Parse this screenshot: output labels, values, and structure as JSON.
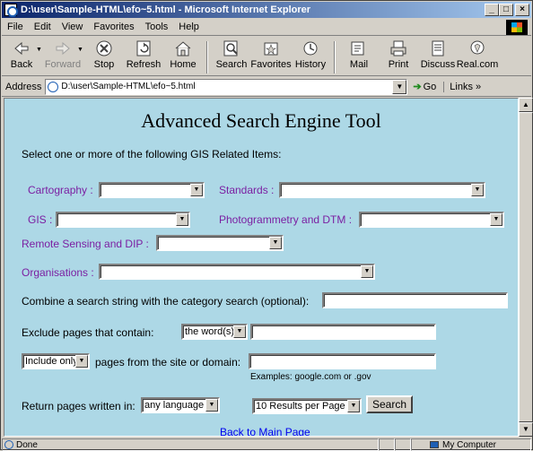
{
  "window": {
    "title": "D:\\user\\Sample-HTML\\efo~5.html - Microsoft Internet Explorer",
    "min": "_",
    "max": "□",
    "close": "×"
  },
  "menu": [
    "File",
    "Edit",
    "View",
    "Favorites",
    "Tools",
    "Help"
  ],
  "toolbar": {
    "back": "Back",
    "forward": "Forward",
    "stop": "Stop",
    "refresh": "Refresh",
    "home": "Home",
    "search": "Search",
    "favorites": "Favorites",
    "history": "History",
    "mail": "Mail",
    "print": "Print",
    "discuss": "Discuss",
    "realcom": "Real.com"
  },
  "address": {
    "label": "Address",
    "url": "D:\\user\\Sample-HTML\\efo~5.html",
    "go": "Go",
    "links": "Links »"
  },
  "page": {
    "title": "Advanced Search Engine Tool",
    "intro": "Select one or more of the following GIS Related Items:",
    "cartography_label": "Cartography :",
    "standards_label": "Standards :",
    "gis_label": "GIS :",
    "photogrammetry_label": "Photogrammetry and DTM :",
    "remote_sensing_label": "Remote Sensing and DIP :",
    "organisations_label": "Organisations :",
    "combine_label": "Combine a search string with the category search (optional):",
    "exclude_label": "Exclude pages that contain:",
    "exclude_option": "the word(s)",
    "include_option": "Include only",
    "site_label": "pages from the site or domain:",
    "examples": "Examples: google.com or .gov",
    "language_label": "Return pages written in:",
    "language_option": "any language",
    "results_option": "10 Results per Page",
    "search_button": "Search",
    "back_link": "Back to Main Page"
  },
  "status": {
    "text": "Done",
    "zone": "My Computer"
  }
}
